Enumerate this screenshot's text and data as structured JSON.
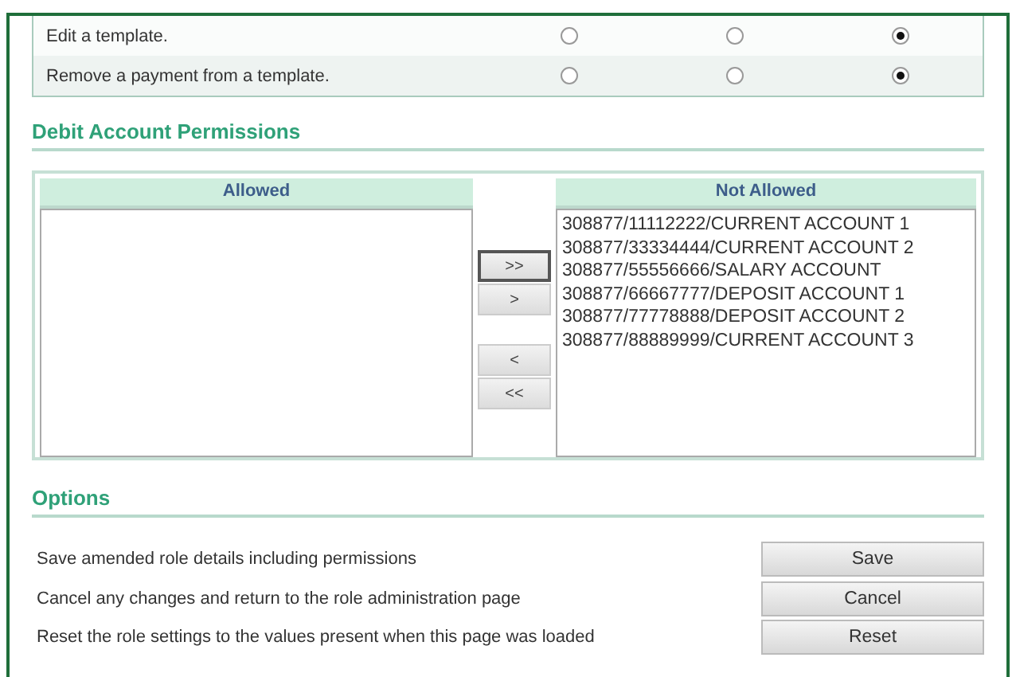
{
  "permission_rows": [
    {
      "label": "Edit a template.",
      "options": [
        {
          "selected": false
        },
        {
          "selected": false
        },
        {
          "selected": true
        }
      ]
    },
    {
      "label": "Remove a payment from a template.",
      "options": [
        {
          "selected": false
        },
        {
          "selected": false
        },
        {
          "selected": true
        }
      ]
    }
  ],
  "debit_section": {
    "title": "Debit Account Permissions",
    "allowed": {
      "header": "Allowed"
    },
    "transfer_buttons": [
      {
        "label": ">>",
        "focused": true
      },
      {
        "label": ">",
        "focused": false
      },
      {
        "label": "<",
        "focused": false
      },
      {
        "label": "<<",
        "focused": false
      }
    ],
    "not_allowed": {
      "header": "Not Allowed",
      "items": [
        "308877/11112222/CURRENT ACCOUNT 1",
        "308877/33334444/CURRENT ACCOUNT 2",
        "308877/55556666/SALARY ACCOUNT",
        "308877/66667777/DEPOSIT ACCOUNT 1",
        "308877/77778888/DEPOSIT ACCOUNT 2",
        "308877/88889999/CURRENT ACCOUNT 3"
      ]
    }
  },
  "options_section": {
    "title": "Options",
    "rows": [
      {
        "description": "Save amended role details including permissions",
        "button": "Save"
      },
      {
        "description": "Cancel any changes and return to the role administration page",
        "button": "Cancel"
      },
      {
        "description": "Reset the role settings to the values present when this page was loaded",
        "button": "Reset"
      }
    ]
  }
}
